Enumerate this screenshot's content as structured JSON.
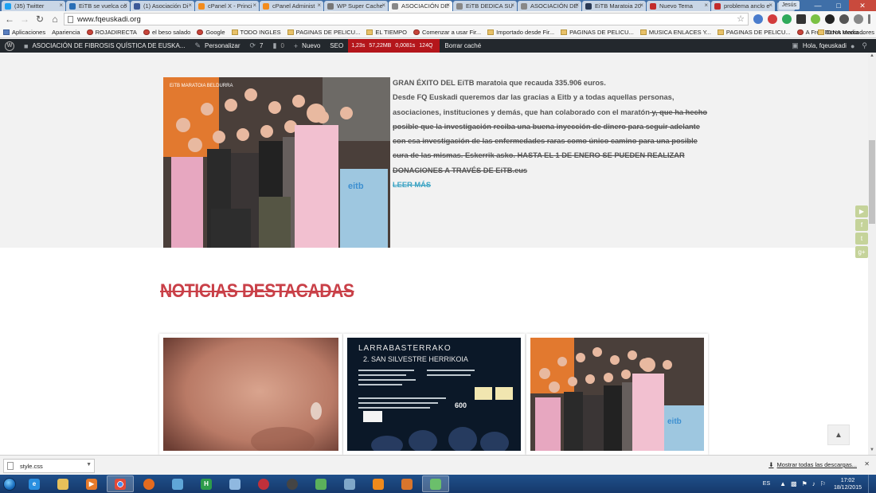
{
  "browser": {
    "tabs": [
      {
        "label": "(35) Twitter",
        "color": "#1da1f2"
      },
      {
        "label": "EiTB se vuelca co",
        "color": "#2a6fb6"
      },
      {
        "label": "(1) Asociación Di",
        "color": "#3b5998"
      },
      {
        "label": "cPanel X - Princi",
        "color": "#f38c1d"
      },
      {
        "label": "cPanel Administ",
        "color": "#f38c1d"
      },
      {
        "label": "WP Super Cache",
        "color": "#777777"
      },
      {
        "label": "ASOCIACIÓN DE",
        "color": "#888888"
      },
      {
        "label": "EiTB DEDICA SU",
        "color": "#888888"
      },
      {
        "label": "ASOCIACIÓN DE",
        "color": "#888888"
      },
      {
        "label": "EiTB Maratoia 20",
        "color": "#2a3a55"
      },
      {
        "label": "Nuevo Tema",
        "color": "#c22b2b"
      },
      {
        "label": "problema anclo e",
        "color": "#c22b2b"
      }
    ],
    "active_tab_index": 6,
    "user_badge": "Jesús",
    "url": "www.fqeuskadi.org",
    "bookmarks": [
      {
        "label": "Aplicaciones",
        "kind": "apps"
      },
      {
        "label": "Apariencia",
        "kind": "page"
      },
      {
        "label": "ROJADIRECTA",
        "kind": "site"
      },
      {
        "label": "el beso salado",
        "kind": "site"
      },
      {
        "label": "Google",
        "kind": "site"
      },
      {
        "label": "TODO INGLES",
        "kind": "folder"
      },
      {
        "label": "PAGINAS DE PELICU...",
        "kind": "folder"
      },
      {
        "label": "EL TIEMPO",
        "kind": "folder"
      },
      {
        "label": "Comenzar a usar Fir...",
        "kind": "site"
      },
      {
        "label": "Importado desde Fir...",
        "kind": "folder"
      },
      {
        "label": "PAGINAS DE PELICU...",
        "kind": "folder"
      },
      {
        "label": "MUSICA ENLACES Y...",
        "kind": "folder"
      },
      {
        "label": "PAGINAS DE PELICU...",
        "kind": "folder"
      },
      {
        "label": "A Free DLNA Media ...",
        "kind": "site"
      }
    ],
    "bookmarks_more": "»",
    "other_bookmarks": "Otros marcadores"
  },
  "wpbar": {
    "site_name": "ASOCIACIÓN DE FIBROSIS QUÍSTICA DE EUSKA...",
    "customize": "Personalizar",
    "updates": "7",
    "comments": "0",
    "new": "Nuevo",
    "seo": "SEO",
    "debug": [
      "1,23s",
      "57,22MB",
      "0,0081s",
      "124Q"
    ],
    "clear_cache": "Borrar caché",
    "greeting": "Hola, fqeuskadi"
  },
  "hero": {
    "headline": "GRAN ÉXITO DEL EiTB maratoia que recauda 335.906 euros.",
    "body_plain": "Desde FQ Euskadi queremos dar las gracias a Eitb y a todas aquellas personas, asociaciones, instituciones y demás, que han colaborado con el maratón",
    "body_strike": " y, que ha hecho posible que la investigación reciba una buena inyección de dinero para seguir adelante con esa investigación de las enfermedades raras como único camino para una posible cura de las mismas. Eskerrik asko. HASTA EL 1 DE ENERO SE PUEDEN REALIZAR DONACIONES A TRAVÉS DE EiTB.eus",
    "read_more": "LEER MÁS",
    "banner_text": "EiTB MARATOIA BELDURRA",
    "screen_logo": "eitb"
  },
  "section": {
    "title": "NOTICIAS DESTACADAS"
  },
  "poster": {
    "line1": "LARRABASTERRAKO",
    "line2": "2. SAN SILVESTRE HERRIKOIA",
    "number": "600"
  },
  "share": [
    "youtube",
    "f",
    "t",
    "g+"
  ],
  "downloads": {
    "file": "style.css",
    "show_all": "Mostrar todas las descargas..."
  },
  "taskbar": {
    "lang": "ES",
    "time": "17:02",
    "date": "18/12/2015"
  }
}
